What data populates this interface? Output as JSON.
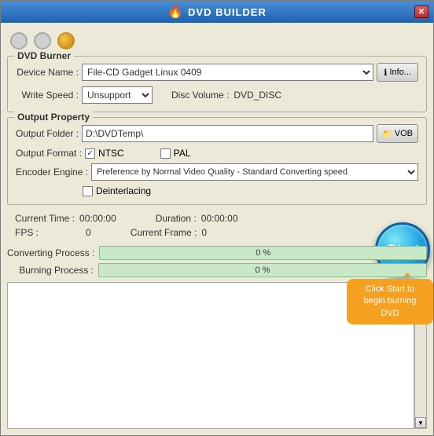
{
  "window": {
    "title": "DVD BUILDER",
    "close_label": "✕"
  },
  "traffic_lights": {
    "colors": [
      "gray",
      "gray",
      "yellow"
    ]
  },
  "dvd_burner": {
    "group_title": "DVD Burner",
    "device_name_label": "Device Name :",
    "device_name_value": "File-CD Gadget  Linux   0409",
    "info_button_label": "Info...",
    "write_speed_label": "Write Speed :",
    "write_speed_value": "Unsupport",
    "disc_volume_label": "Disc Volume :",
    "disc_volume_value": "DVD_DISC"
  },
  "output_property": {
    "group_title": "Output Property",
    "output_folder_label": "Output Folder :",
    "output_folder_value": "D:\\DVDTemp\\",
    "vob_button_label": "VOB",
    "output_format_label": "Output Format :",
    "ntsc_label": "NTSC",
    "ntsc_checked": true,
    "pal_label": "PAL",
    "pal_checked": false,
    "encoder_engine_label": "Encoder Engine :",
    "encoder_engine_value": "Preference by Normal Video Quality - Standard Converting speed",
    "deinterlacing_label": "Deinterlacing",
    "deinterlacing_checked": false
  },
  "stats": {
    "current_time_label": "Current Time :",
    "current_time_value": "00:00:00",
    "duration_label": "Duration :",
    "duration_value": "00:00:00",
    "fps_label": "FPS :",
    "fps_value": "0",
    "current_frame_label": "Current Frame :",
    "current_frame_value": "0"
  },
  "progress": {
    "converting_label": "Converting Process :",
    "converting_percent": "0 %",
    "converting_value": 0,
    "burning_label": "Burning Process :",
    "burning_percent": "0 %",
    "burning_value": 0
  },
  "start_button": {
    "label": "Start"
  },
  "tooltip": {
    "text": "Click Start to begin burning DVD"
  }
}
